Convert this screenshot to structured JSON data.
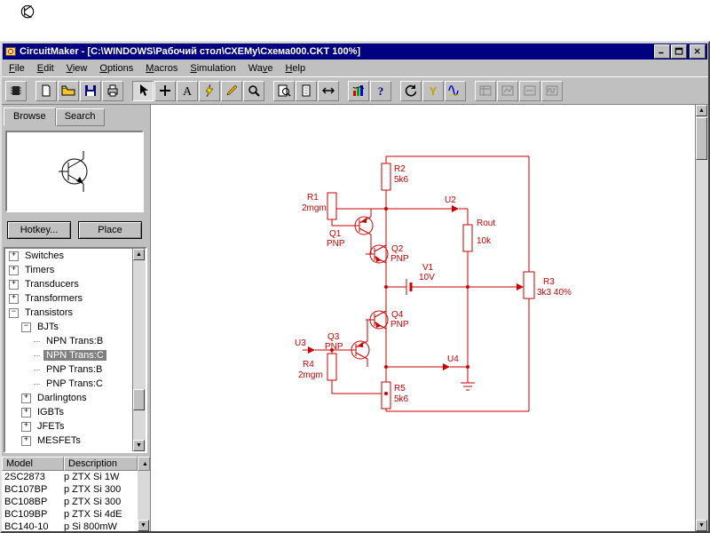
{
  "colors": {
    "titlebar": "#000080",
    "chrome": "#c0c0c0",
    "circuit": "#cc0000",
    "selection": "#808080"
  },
  "window": {
    "title": "CircuitMaker - [C:\\WINDOWS\\Рабочий стол\\СХЕМу\\Схема000.CKT 100%]",
    "controls": [
      {
        "name": "minimize",
        "icon": "winmin"
      },
      {
        "name": "maximize",
        "icon": "winmax"
      },
      {
        "name": "close",
        "icon": "winclose"
      }
    ]
  },
  "menu": {
    "items": [
      {
        "label": "File",
        "u": 0
      },
      {
        "label": "Edit",
        "u": 0
      },
      {
        "label": "View",
        "u": 0
      },
      {
        "label": "Options",
        "u": 0
      },
      {
        "label": "Macros",
        "u": 0
      },
      {
        "label": "Simulation",
        "u": 0
      },
      {
        "label": "Wave",
        "u": 2
      },
      {
        "label": "Help",
        "u": 0
      }
    ]
  },
  "toolbar": {
    "groups": [
      [
        {
          "name": "device-select",
          "icon": "chip"
        }
      ],
      [
        {
          "name": "new",
          "icon": "new"
        },
        {
          "name": "open",
          "icon": "open"
        },
        {
          "name": "save",
          "icon": "save"
        },
        {
          "name": "print",
          "icon": "print"
        }
      ],
      [
        {
          "name": "arrow-tool",
          "icon": "arrow",
          "pressed": true
        },
        {
          "name": "wire-tool",
          "icon": "plus"
        },
        {
          "name": "text-tool",
          "icon": "texta"
        },
        {
          "name": "delete-tool",
          "icon": "bolt"
        },
        {
          "name": "edit-tool",
          "icon": "pencil"
        },
        {
          "name": "zoom-tool",
          "icon": "zoom"
        }
      ],
      [
        {
          "name": "zoom-fit",
          "icon": "fitpage"
        },
        {
          "name": "zoom-normal",
          "icon": "page"
        },
        {
          "name": "pan",
          "icon": "pan"
        }
      ],
      [
        {
          "name": "analyses",
          "icon": "analyses"
        },
        {
          "name": "help",
          "icon": "help"
        }
      ],
      [
        {
          "name": "reset",
          "icon": "reset"
        },
        {
          "name": "probe",
          "icon": "probey"
        },
        {
          "name": "waveforms",
          "icon": "wave"
        }
      ],
      [
        {
          "name": "step",
          "icon": "grid1",
          "disabled": true
        },
        {
          "name": "trace",
          "icon": "grid2",
          "disabled": true
        },
        {
          "name": "breakpoint",
          "icon": "grid3",
          "disabled": true
        },
        {
          "name": "logic-display",
          "icon": "grid4",
          "disabled": true
        }
      ]
    ]
  },
  "sidebar": {
    "tabs": [
      "Browse",
      "Search"
    ],
    "hotkey_button": "Hotkey...",
    "place_button": "Place",
    "tree": [
      {
        "label": "Switches",
        "level": 0,
        "toggle": "plus"
      },
      {
        "label": "Timers",
        "level": 0,
        "toggle": "plus"
      },
      {
        "label": "Transducers",
        "level": 0,
        "toggle": "plus"
      },
      {
        "label": "Transformers",
        "level": 0,
        "toggle": "plus"
      },
      {
        "label": "Transistors",
        "level": 0,
        "toggle": "minus"
      },
      {
        "label": "BJTs",
        "level": 1,
        "toggle": "minus"
      },
      {
        "label": "NPN Trans:B",
        "level": 2,
        "toggle": "none"
      },
      {
        "label": "NPN Trans:C",
        "level": 2,
        "toggle": "none",
        "selected": true
      },
      {
        "label": "PNP Trans:B",
        "level": 2,
        "toggle": "none"
      },
      {
        "label": "PNP Trans:C",
        "level": 2,
        "toggle": "none"
      },
      {
        "label": "Darlingtons",
        "level": 1,
        "toggle": "plus"
      },
      {
        "label": "IGBTs",
        "level": 1,
        "toggle": "plus"
      },
      {
        "label": "JFETs",
        "level": 1,
        "toggle": "plus"
      },
      {
        "label": "MESFETs",
        "level": 1,
        "toggle": "plus"
      }
    ],
    "models": {
      "headers": [
        "Model",
        "Description"
      ],
      "rows": [
        [
          "2SC2873",
          "p ZTX Si 1W"
        ],
        [
          "BC107BP",
          "p ZTX Si 300"
        ],
        [
          "BC108BP",
          "p ZTX Si 300"
        ],
        [
          "BC109BP",
          "p ZTX Si 4dE"
        ],
        [
          "BC140-10",
          "p Si 800mW"
        ]
      ]
    }
  },
  "schematic": {
    "components": [
      {
        "ref": "R1",
        "value": "2mgm",
        "type": "resistor"
      },
      {
        "ref": "R2",
        "value": "5k6",
        "type": "resistor"
      },
      {
        "ref": "R3",
        "value": "3k3 40%",
        "type": "potentiometer"
      },
      {
        "ref": "R4",
        "value": "2mgm",
        "type": "resistor"
      },
      {
        "ref": "R5",
        "value": "5k6",
        "type": "resistor"
      },
      {
        "ref": "Rout",
        "value": "10k",
        "type": "resistor"
      },
      {
        "ref": "Q1",
        "value": "PNP",
        "type": "transistor"
      },
      {
        "ref": "Q2",
        "value": "PNP",
        "type": "transistor"
      },
      {
        "ref": "Q3",
        "value": "PNP",
        "type": "transistor"
      },
      {
        "ref": "Q4",
        "value": "PNP",
        "type": "transistor"
      },
      {
        "ref": "V1",
        "value": "10V",
        "type": "battery"
      },
      {
        "ref": "U2",
        "value": "",
        "type": "terminal"
      },
      {
        "ref": "U3",
        "value": "",
        "type": "terminal"
      },
      {
        "ref": "U4",
        "value": "",
        "type": "terminal"
      }
    ]
  }
}
